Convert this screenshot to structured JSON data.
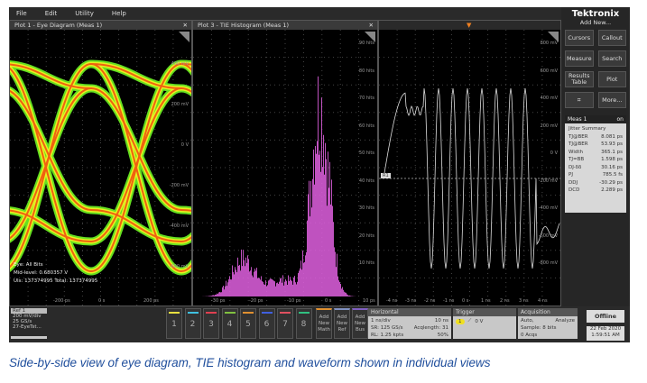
{
  "menu": [
    "File",
    "Edit",
    "Utility",
    "Help"
  ],
  "plot1": {
    "title": "Plot 1 - Eye Diagram (Meas 1)",
    "eye": "Eye:  All Bits",
    "midlevel": "Mid-level:  0.680357 V",
    "uis": "UIs:  137374995   Total:  137374995",
    "yticks": [
      "400 mV",
      "200 mV",
      "0 V",
      "-200 mV",
      "-400 mV",
      "-600 mV"
    ],
    "xticks": [
      "-200 ps",
      "0 s",
      "200 ps"
    ]
  },
  "plot3": {
    "title": "Plot 3 - TIE Histogram (Meas 1)",
    "yticks": [
      "90 hits",
      "80 hits",
      "70 hits",
      "60 hits",
      "50 hits",
      "40 hits",
      "30 hits",
      "20 hits",
      "10 hits"
    ],
    "xticks": [
      "-30 ps",
      "-20 ps",
      "-10 ps",
      "0 s",
      "10 ps"
    ]
  },
  "plot4": {
    "ref_marker": "R1",
    "yticks": [
      "800 mV",
      "600 mV",
      "400 mV",
      "200 mV",
      "0 V",
      "-200 mV",
      "-400 mV",
      "-600 mV",
      "-800 mV"
    ],
    "xticks": [
      "-4 ns",
      "-3 ns",
      "-2 ns",
      "-1 ns",
      "0 s",
      "1 ns",
      "2 ns",
      "3 ns",
      "4 ns"
    ]
  },
  "right": {
    "brand": "Tektronix",
    "add_new": "Add New...",
    "buttons": [
      "Cursors",
      "Callout",
      "Measure",
      "Search",
      "Results Table",
      "Plot",
      "",
      "More..."
    ],
    "meas": {
      "title": "Meas 1",
      "badge": "on",
      "subtitle": "Jitter Summary",
      "rows": [
        [
          "TJ@BER",
          "8.081 ps"
        ],
        [
          "TJ@BER",
          "53.93 ps"
        ],
        [
          "Width",
          "365.1 ps"
        ],
        [
          "TJ=BB",
          "1.598 ps"
        ],
        [
          "DJ-δδ",
          "30.16 ps"
        ],
        [
          "PJ",
          "785.5 fs"
        ],
        [
          "DDJ",
          "-30.29 ps"
        ],
        [
          "DCD",
          "2.289 ps"
        ]
      ]
    }
  },
  "bottom": {
    "ref": {
      "title": "Ref 1",
      "lines": [
        "200 mV/div",
        "25 GS/s",
        "27-EyeTst..."
      ]
    },
    "channels": [
      {
        "n": "1",
        "color": "#e8e040"
      },
      {
        "n": "2",
        "color": "#40c0e0"
      },
      {
        "n": "3",
        "color": "#e04050"
      },
      {
        "n": "4",
        "color": "#80c040"
      },
      {
        "n": "5",
        "color": "#e09030"
      },
      {
        "n": "6",
        "color": "#4060e0"
      },
      {
        "n": "7",
        "color": "#e05060"
      },
      {
        "n": "8",
        "color": "#30c080"
      }
    ],
    "add": [
      {
        "label": "Add New Math",
        "color": "#e09030"
      },
      {
        "label": "Add New Ref",
        "color": "#8090c0"
      },
      {
        "label": "Add New Bus",
        "color": "#8060c0"
      }
    ],
    "horizontal": {
      "title": "Horizontal",
      "lines": [
        [
          "1 ns/div",
          "10 ns"
        ],
        [
          "SR: 125 GS/s",
          "Acqlength: 31"
        ],
        [
          "RL: 1.25 kpts",
          "50%"
        ]
      ]
    },
    "trigger": {
      "title": "Trigger",
      "source": "1",
      "level": "0 V"
    },
    "acquisition": {
      "title": "Acquisition",
      "lines": [
        [
          "Auto,",
          "Analyze"
        ],
        [
          "Sample: 8 bits",
          ""
        ],
        [
          "0 Acqs",
          ""
        ]
      ]
    },
    "offline": "Offline",
    "date": "22 Feb 2020",
    "time": "1:59:51 AM"
  },
  "caption": "Side-by-side view of eye diagram, TIE histogram and waveform shown in individual views"
}
